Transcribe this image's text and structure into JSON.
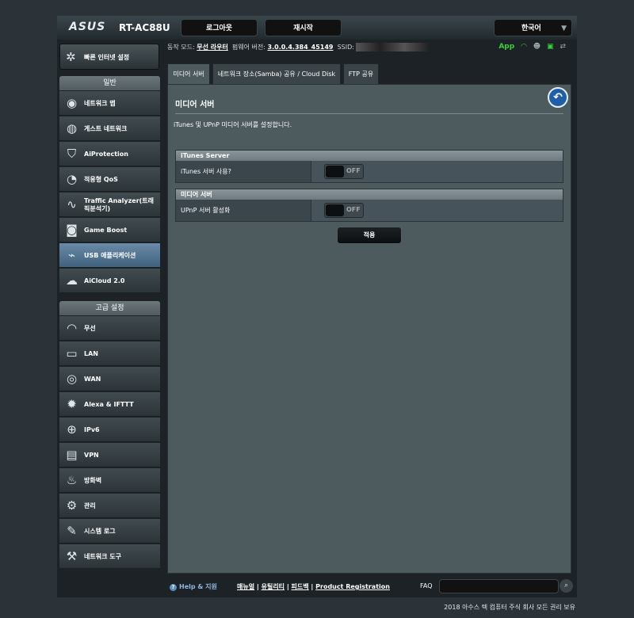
{
  "header": {
    "brand": "ASUS",
    "model": "RT-AC88U",
    "logout_label": "로그아웃",
    "reboot_label": "재시작",
    "language": "한국어"
  },
  "sidebar": {
    "quick_setup": "빠른 인터넷 설정",
    "general_label": "일반",
    "general_items": [
      {
        "label": "네트워크 맵",
        "icon": "network-map-icon"
      },
      {
        "label": "게스트 네트워크",
        "icon": "guest-network-icon"
      },
      {
        "label": "AiProtection",
        "icon": "aiprotection-icon"
      },
      {
        "label": "적응형 QoS",
        "icon": "qos-icon"
      },
      {
        "label": "Traffic Analyzer(트래픽분석기)",
        "icon": "traffic-analyzer-icon"
      },
      {
        "label": "Game Boost",
        "icon": "game-boost-icon"
      },
      {
        "label": "USB 애플리케이션",
        "icon": "usb-icon",
        "active": true
      },
      {
        "label": "AiCloud 2.0",
        "icon": "cloud-icon"
      }
    ],
    "advanced_label": "고급 설정",
    "advanced_items": [
      {
        "label": "무선",
        "icon": "wireless-icon"
      },
      {
        "label": "LAN",
        "icon": "lan-icon"
      },
      {
        "label": "WAN",
        "icon": "wan-icon"
      },
      {
        "label": "Alexa & IFTTT",
        "icon": "alexa-icon"
      },
      {
        "label": "IPv6",
        "icon": "ipv6-icon"
      },
      {
        "label": "VPN",
        "icon": "vpn-icon"
      },
      {
        "label": "방화벽",
        "icon": "firewall-icon"
      },
      {
        "label": "관리",
        "icon": "admin-icon"
      },
      {
        "label": "시스템 로그",
        "icon": "system-log-icon"
      },
      {
        "label": "네트워크 도구",
        "icon": "network-tools-icon"
      }
    ]
  },
  "status": {
    "mode_label": "동작 모드:",
    "mode_value": "무선 라우터",
    "firmware_label": "펌웨어 버전:",
    "firmware_value": "3.0.0.4.384_45149",
    "ssid_label": "SSID:",
    "app_label": "App"
  },
  "tabs": [
    {
      "label": "미디어 서버",
      "active": true
    },
    {
      "label": "네트워크 장소(Samba) 공유 / Cloud Disk"
    },
    {
      "label": "FTP 공유"
    }
  ],
  "content": {
    "title": "미디어 서버",
    "description": "iTunes 및 UPnP 미디어 서버를 설정합니다.",
    "itunes_section": "iTunes Server",
    "itunes_row_label": "iTunes 서버 사용?",
    "itunes_toggle": "OFF",
    "media_section": "미디어 서버",
    "upnp_row_label": "UPnP 서버 활성화",
    "upnp_toggle": "OFF",
    "apply_label": "적용"
  },
  "footer": {
    "help_label": "Help & 지원",
    "link_manual": "매뉴얼",
    "link_utility": "유틸리티",
    "link_feedback": "피드백",
    "link_registration": "Product Registration",
    "faq_label": "FAQ",
    "copyright": "2018 아수스 텍 컴퓨터 주식 회사 모든 권리 보유"
  }
}
